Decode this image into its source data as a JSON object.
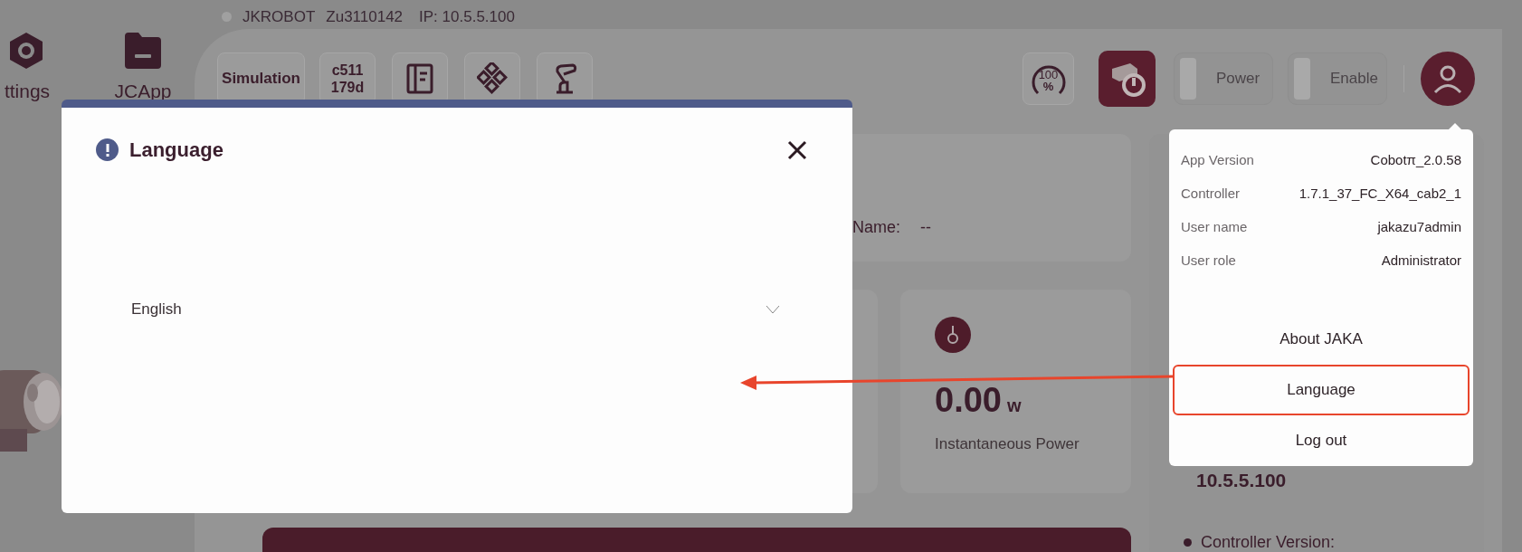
{
  "status": {
    "robot": "JKROBOT",
    "serial": "Zu3110142",
    "ip": "IP: 10.5.5.100",
    "online": false
  },
  "nav": [
    {
      "label": "ttings",
      "kind": "settings"
    },
    {
      "label": "JCApp",
      "kind": "folder"
    }
  ],
  "toolbar": {
    "mode": "Simulation",
    "id_lines": [
      "c511",
      "179d"
    ],
    "speed": [
      "100",
      "%"
    ],
    "switches": [
      {
        "label": "Power",
        "on": false
      },
      {
        "label": "Enable",
        "on": false
      }
    ]
  },
  "info_card": {
    "label": "Name:",
    "value": "--"
  },
  "power_card": {
    "value": "0.00",
    "unit": "w",
    "label": "Instantaneous Power"
  },
  "side_panel": {
    "ip": "10.5.5.100",
    "label": "Controller Version:"
  },
  "dialog": {
    "title": "Language",
    "select": {
      "value": "English"
    }
  },
  "menu": {
    "info": [
      {
        "label": "App Version",
        "value": "Cobotπ_2.0.58"
      },
      {
        "label": "Controller",
        "value": "1.7.1_37_FC_X64_cab2_1"
      },
      {
        "label": "User name",
        "value": "jakazu7admin"
      },
      {
        "label": "User role",
        "value": "Administrator"
      }
    ],
    "actions": [
      {
        "label": "About JAKA",
        "highlighted": false
      },
      {
        "label": "Language",
        "highlighted": true
      },
      {
        "label": "Log out",
        "highlighted": false
      }
    ]
  }
}
